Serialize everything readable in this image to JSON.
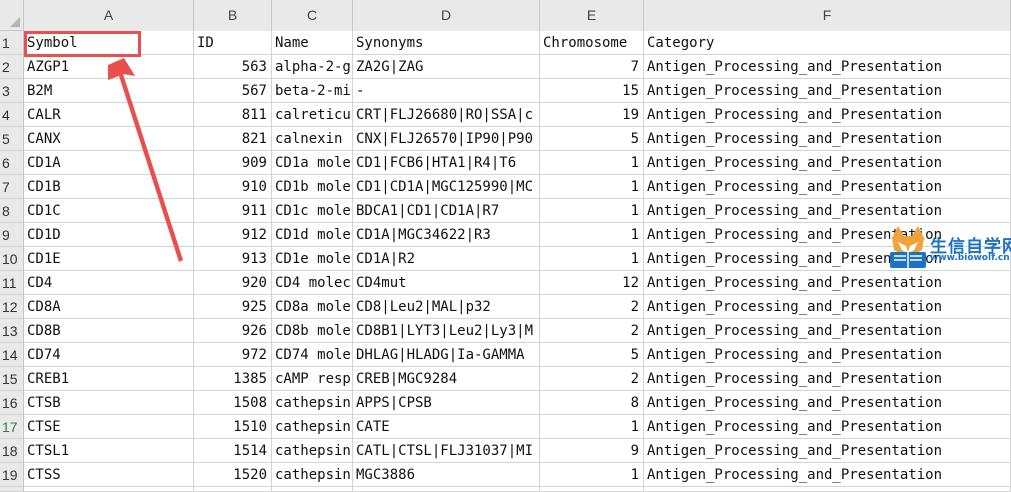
{
  "columns": [
    "A",
    "B",
    "C",
    "D",
    "E",
    "F"
  ],
  "rows": [
    {
      "n": "1",
      "a": "Symbol",
      "b": "ID",
      "c": "Name",
      "d": "Synonyms",
      "e": "Chromosome",
      "f": "Category",
      "header": true
    },
    {
      "n": "2",
      "a": "AZGP1",
      "b": "563",
      "c": "alpha-2-g",
      "d": "ZA2G|ZAG",
      "e": "7",
      "f": "Antigen_Processing_and_Presentation"
    },
    {
      "n": "3",
      "a": "B2M",
      "b": "567",
      "c": "beta-2-mi",
      "d": "-",
      "e": "15",
      "f": "Antigen_Processing_and_Presentation"
    },
    {
      "n": "4",
      "a": "CALR",
      "b": "811",
      "c": "calreticu",
      "d": "CRT|FLJ26680|RO|SSA|c",
      "e": "19",
      "f": "Antigen_Processing_and_Presentation"
    },
    {
      "n": "5",
      "a": "CANX",
      "b": "821",
      "c": "calnexin",
      "d": "CNX|FLJ26570|IP90|P90",
      "e": "5",
      "f": "Antigen_Processing_and_Presentation"
    },
    {
      "n": "6",
      "a": "CD1A",
      "b": "909",
      "c": "CD1a mole",
      "d": "CD1|FCB6|HTA1|R4|T6",
      "e": "1",
      "f": "Antigen_Processing_and_Presentation"
    },
    {
      "n": "7",
      "a": "CD1B",
      "b": "910",
      "c": "CD1b mole",
      "d": "CD1|CD1A|MGC125990|MC",
      "e": "1",
      "f": "Antigen_Processing_and_Presentation"
    },
    {
      "n": "8",
      "a": "CD1C",
      "b": "911",
      "c": "CD1c mole",
      "d": "BDCA1|CD1|CD1A|R7",
      "e": "1",
      "f": "Antigen_Processing_and_Presentation"
    },
    {
      "n": "9",
      "a": "CD1D",
      "b": "912",
      "c": "CD1d mole",
      "d": "CD1A|MGC34622|R3",
      "e": "1",
      "f": "Antigen_Processing_and_Presentation"
    },
    {
      "n": "10",
      "a": "CD1E",
      "b": "913",
      "c": "CD1e mole",
      "d": "CD1A|R2",
      "e": "1",
      "f": "Antigen_Processing_and_Presentation"
    },
    {
      "n": "11",
      "a": "CD4",
      "b": "920",
      "c": "CD4 molec",
      "d": "CD4mut",
      "e": "12",
      "f": "Antigen_Processing_and_Presentation"
    },
    {
      "n": "12",
      "a": "CD8A",
      "b": "925",
      "c": "CD8a mole",
      "d": "CD8|Leu2|MAL|p32",
      "e": "2",
      "f": "Antigen_Processing_and_Presentation"
    },
    {
      "n": "13",
      "a": "CD8B",
      "b": "926",
      "c": "CD8b mole",
      "d": "CD8B1|LYT3|Leu2|Ly3|M",
      "e": "2",
      "f": "Antigen_Processing_and_Presentation"
    },
    {
      "n": "14",
      "a": "CD74",
      "b": "972",
      "c": "CD74 mole",
      "d": "DHLAG|HLADG|Ia-GAMMA",
      "e": "5",
      "f": "Antigen_Processing_and_Presentation"
    },
    {
      "n": "15",
      "a": "CREB1",
      "b": "1385",
      "c": "cAMP resp",
      "d": "CREB|MGC9284",
      "e": "2",
      "f": "Antigen_Processing_and_Presentation"
    },
    {
      "n": "16",
      "a": "CTSB",
      "b": "1508",
      "c": "cathepsin",
      "d": "APPS|CPSB",
      "e": "8",
      "f": "Antigen_Processing_and_Presentation"
    },
    {
      "n": "17",
      "a": "CTSE",
      "b": "1510",
      "c": "cathepsin",
      "d": "CATE",
      "e": "1",
      "f": "Antigen_Processing_and_Presentation"
    },
    {
      "n": "18",
      "a": "CTSL1",
      "b": "1514",
      "c": "cathepsin",
      "d": "CATL|CTSL|FLJ31037|MI",
      "e": "9",
      "f": "Antigen_Processing_and_Presentation"
    },
    {
      "n": "19",
      "a": "CTSS",
      "b": "1520",
      "c": "cathepsin",
      "d": "MGC3886",
      "e": "1",
      "f": "Antigen_Processing_and_Presentation"
    }
  ],
  "watermark": {
    "text": "生信自学网",
    "url": "www.biowolf.cn"
  },
  "colors": {
    "annotation": "#e8504e",
    "watermark": "#1b72c5",
    "header_bg": "#e9e9e9"
  }
}
